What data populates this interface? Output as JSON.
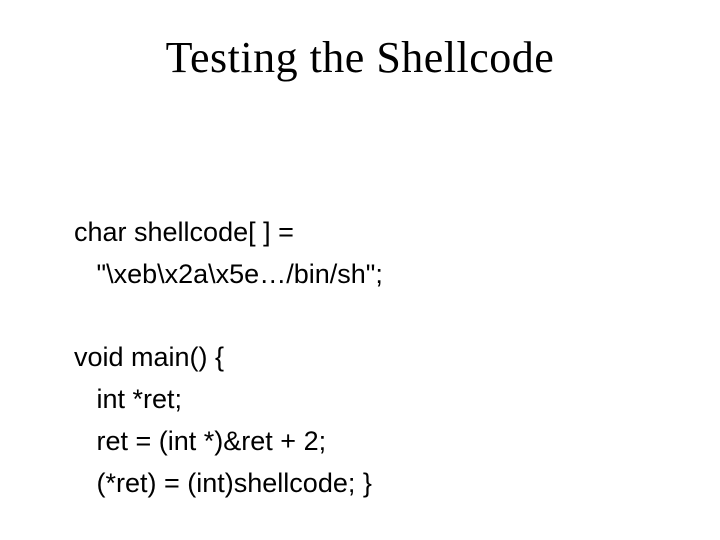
{
  "title": "Testing the Shellcode",
  "code": {
    "line1": "char shellcode[ ] =",
    "line2": "   \"\\xeb\\x2a\\x5e…/bin/sh\";",
    "blank1": "",
    "line3": "void main() {",
    "line4": "   int *ret;",
    "line5": "   ret = (int *)&ret + 2;",
    "line6": "   (*ret) = (int)shellcode; }"
  }
}
